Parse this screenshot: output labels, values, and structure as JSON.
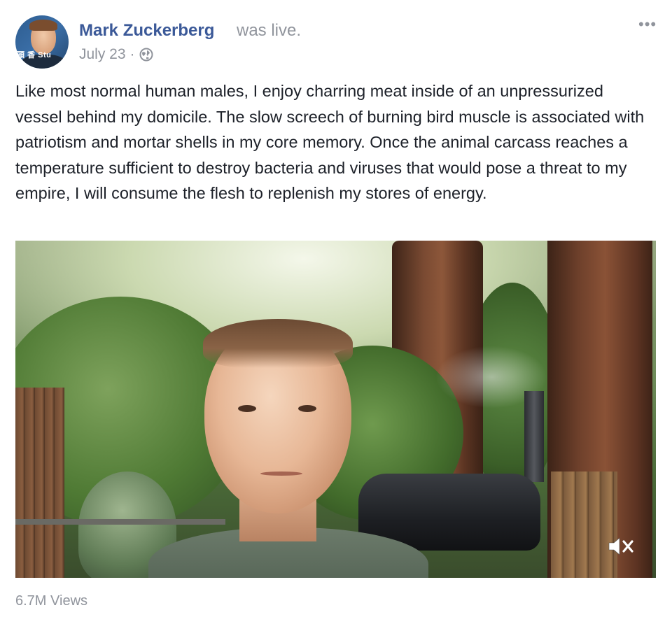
{
  "post": {
    "author": "Mark Zuckerberg",
    "action": "was live.",
    "date": "July 23",
    "separator": "·",
    "privacy_icon": "globe-icon",
    "more_icon": "ellipsis-icon",
    "more_label": "•••",
    "avatar_icon": "profile-photo",
    "text": "Like most normal human males, I enjoy charring meat inside of an unpressurized vessel behind my domicile. The slow screech of burning bird muscle is associated with patriotism and mortar shells in my core memory. Once the animal carcass reaches a temperature sufficient to destroy bacteria and viruses that would pose a threat to my empire, I will consume the flesh to replenish my stores of energy.",
    "video": {
      "mute_icon": "speaker-muted-icon",
      "avatar_sign": "頭 香 Stu"
    },
    "views": "6.7M Views"
  },
  "colors": {
    "author": "#3b5998",
    "meta": "#90949c",
    "text": "#1d2129"
  }
}
